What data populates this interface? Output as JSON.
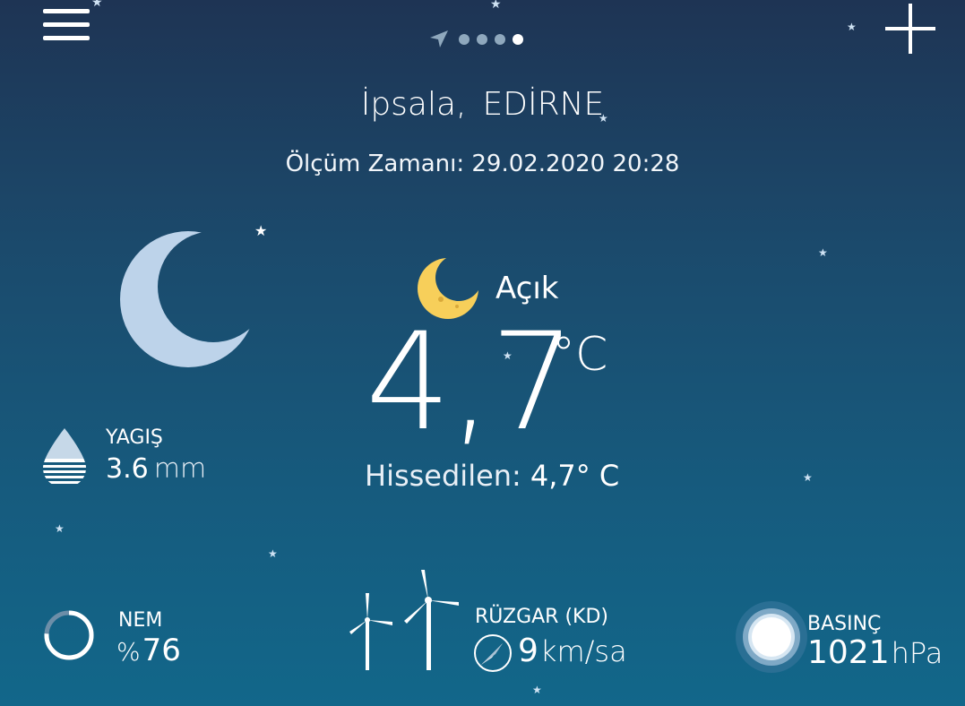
{
  "header": {
    "pager_dots": 4,
    "active_page": 4
  },
  "location": {
    "district": "İpsala,",
    "province": "EDİRNE"
  },
  "measurement": {
    "label": "Ölçüm Zamanı:",
    "time": "29.02.2020 20:28"
  },
  "condition": {
    "text": "Açık",
    "icon": "crescent-moon-icon"
  },
  "temperature": {
    "value": "4,7",
    "unit": "°C",
    "feels_label": "Hissedilen:",
    "feels_value": "4,7° C"
  },
  "precipitation": {
    "label": "YAGIŞ",
    "value": "3.6",
    "unit": "mm"
  },
  "humidity": {
    "label": "NEM",
    "prefix": "%",
    "value": "76",
    "fraction": 0.76
  },
  "wind": {
    "label": "RÜZGAR (KD)",
    "value": "9",
    "unit": "km/sa"
  },
  "pressure": {
    "label": "BASINÇ",
    "value": "1021",
    "unit": "hPa"
  },
  "colors": {
    "background_top": "#1e3454",
    "background_bottom": "#12678a",
    "moon_big": "#bdd3ea",
    "moon_small": "#f7cf5a",
    "text": "#ffffff"
  }
}
